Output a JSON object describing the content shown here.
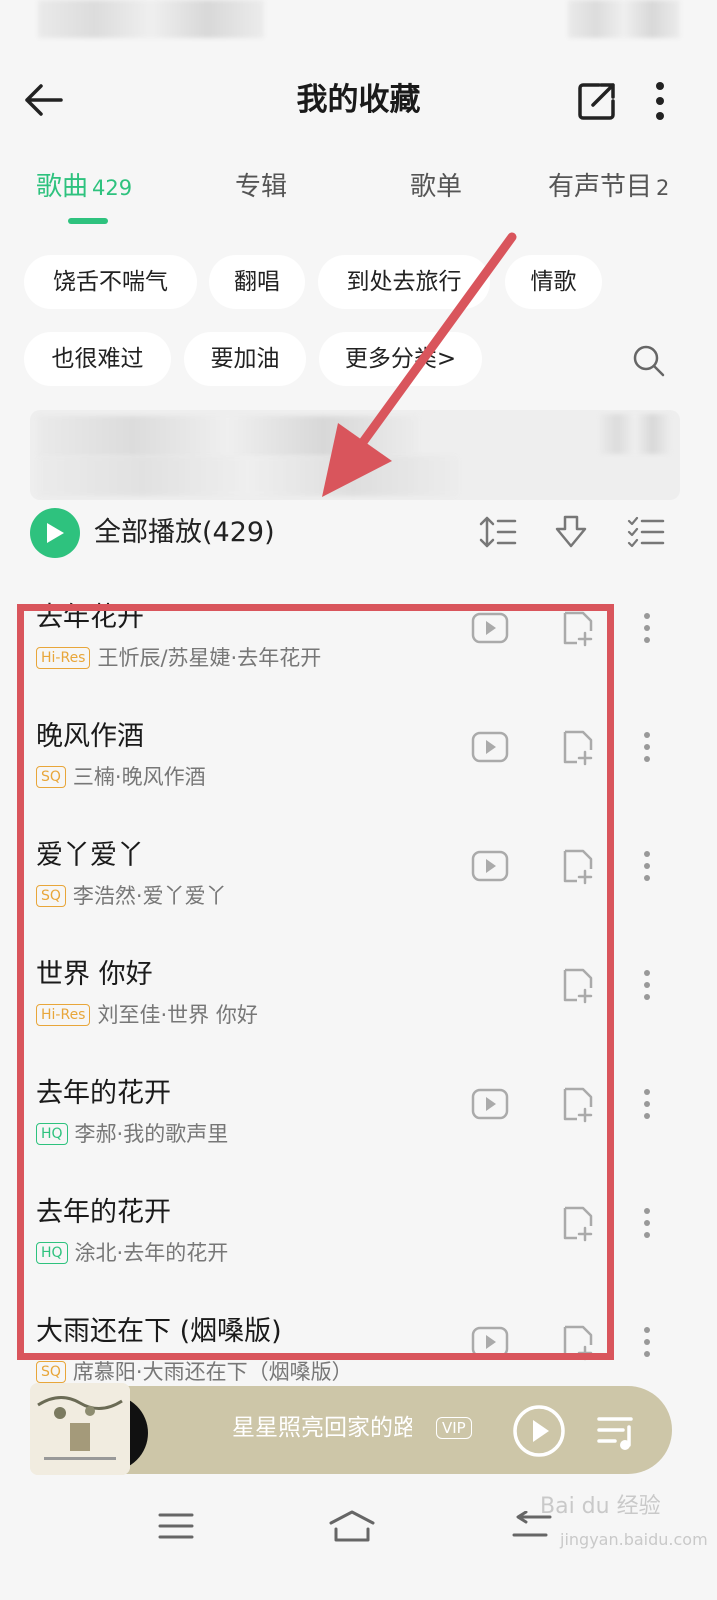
{
  "header": {
    "title": "我的收藏"
  },
  "tabs": [
    {
      "label": "歌曲",
      "count": "429",
      "active": true
    },
    {
      "label": "专辑",
      "count": ""
    },
    {
      "label": "歌单",
      "count": ""
    },
    {
      "label": "有声节目",
      "count": "2"
    }
  ],
  "chips": [
    "饶舌不喘气",
    "翻唱",
    "到处去旅行",
    "情歌",
    "也很难过",
    "要加油",
    "更多分类>"
  ],
  "play_all": {
    "label": "全部播放(429)"
  },
  "songs": [
    {
      "title": "去年花开",
      "badge": "Hi-Res",
      "badge_color": "#e8a63a",
      "sub": "王忻辰/苏星婕·去年花开",
      "has_mv": true
    },
    {
      "title": "晚风作酒",
      "badge": "SQ",
      "badge_color": "#e8a63a",
      "sub": "三楠·晚风作酒",
      "has_mv": true
    },
    {
      "title": "爱丫爱丫",
      "badge": "SQ",
      "badge_color": "#e8a63a",
      "sub": "李浩然·爱丫爱丫",
      "has_mv": true
    },
    {
      "title": "世界 你好",
      "badge": "Hi-Res",
      "badge_color": "#e8a63a",
      "sub": "刘至佳·世界 你好",
      "has_mv": false
    },
    {
      "title": "去年的花开",
      "badge": "HQ",
      "badge_color": "#2ec27e",
      "sub": "李郝·我的歌声里",
      "has_mv": true
    },
    {
      "title": "去年的花开",
      "badge": "HQ",
      "badge_color": "#2ec27e",
      "sub": "涂北·去年的花开",
      "has_mv": false
    },
    {
      "title": "大雨还在下 (烟嗓版)",
      "badge": "SQ",
      "badge_color": "#e8a63a",
      "sub": "席慕阳·大雨还在下（烟嗓版）",
      "has_mv": true
    }
  ],
  "player": {
    "title": "星星照亮回家的路",
    "vip": "VIP"
  },
  "watermark": {
    "line1": "Bai du 经验",
    "line2": "jingyan.baidu.com"
  },
  "colors": {
    "accent": "#2ec27e",
    "highlight": "#d9555c",
    "player_bg": "#cdc6a8"
  }
}
